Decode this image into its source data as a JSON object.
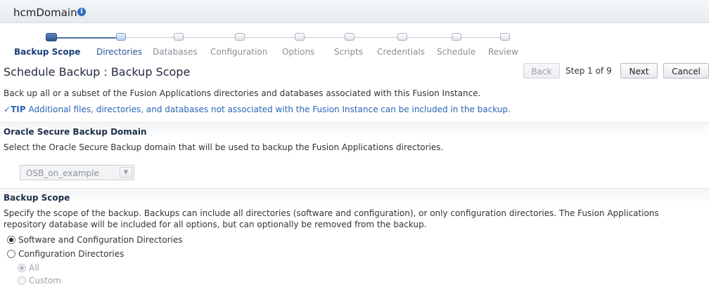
{
  "header": {
    "domain_title": "hcmDomain"
  },
  "train": {
    "steps": [
      {
        "label": "Backup Scope",
        "state": "current"
      },
      {
        "label": "Directories",
        "state": "next"
      },
      {
        "label": "Databases",
        "state": "pending"
      },
      {
        "label": "Configuration",
        "state": "pending"
      },
      {
        "label": "Options",
        "state": "pending"
      },
      {
        "label": "Scripts",
        "state": "pending"
      },
      {
        "label": "Credentials",
        "state": "pending"
      },
      {
        "label": "Schedule",
        "state": "pending"
      },
      {
        "label": "Review",
        "state": "pending"
      }
    ]
  },
  "page": {
    "title": "Schedule Backup : Backup Scope",
    "description": "Back up all or a subset of the Fusion Applications directories and databases associated with this Fusion Instance.",
    "tip_label": "TIP",
    "tip_text": "Additional files, directories, and databases not associated with the Fusion Instance can be included in the backup."
  },
  "navigation": {
    "back_label": "Back",
    "step_text": "Step 1 of 9",
    "next_label": "Next",
    "cancel_label": "Cancel"
  },
  "osb_domain": {
    "title": "Oracle Secure Backup Domain",
    "description": "Select the Oracle Secure Backup domain that will be used to backup the Fusion Applications directories.",
    "selected_value": "OSB_on_example"
  },
  "backup_scope": {
    "title": "Backup Scope",
    "description_line1": "Specify the scope of the backup. Backups can include all directories (software and configuration), or only configuration directories. The Fusion Applications",
    "description_line2": "repository database will be included for all options, but can optionally be removed from the backup.",
    "options": [
      {
        "label": "Software and Configuration Directories",
        "selected": true
      },
      {
        "label": "Configuration Directories",
        "selected": false
      }
    ],
    "sub_options": [
      {
        "label": "All",
        "selected": true
      },
      {
        "label": "Custom",
        "selected": false
      }
    ]
  },
  "colors": {
    "accent": "#2d558f",
    "link": "#2a64b4",
    "section_title": "#1e2f4a"
  }
}
